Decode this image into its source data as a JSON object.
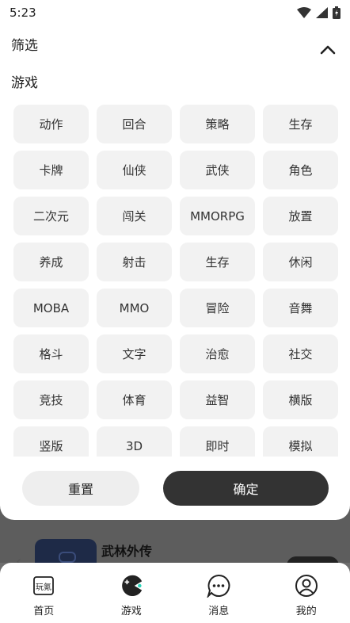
{
  "status_bar": {
    "time": "5:23"
  },
  "filter_sheet": {
    "title": "筛选",
    "section_title": "游戏",
    "tags": [
      "动作",
      "回合",
      "策略",
      "生存",
      "卡牌",
      "仙侠",
      "武侠",
      "角色",
      "二次元",
      "闯关",
      "MMORPG",
      "放置",
      "养成",
      "射击",
      "生存",
      "休闲",
      "MOBA",
      "MMO",
      "冒险",
      "音舞",
      "格斗",
      "文字",
      "治愈",
      "社交",
      "竞技",
      "体育",
      "益智",
      "横版",
      "竖版",
      "3D",
      "即时",
      "模拟"
    ],
    "reset_label": "重置",
    "confirm_label": "确定"
  },
  "background": {
    "game_title": "武林外传"
  },
  "bottom_nav": {
    "items": [
      {
        "label": "首页",
        "icon": "home-logo-icon"
      },
      {
        "label": "游戏",
        "icon": "gamepad-icon"
      },
      {
        "label": "消息",
        "icon": "message-icon"
      },
      {
        "label": "我的",
        "icon": "profile-icon"
      }
    ]
  }
}
